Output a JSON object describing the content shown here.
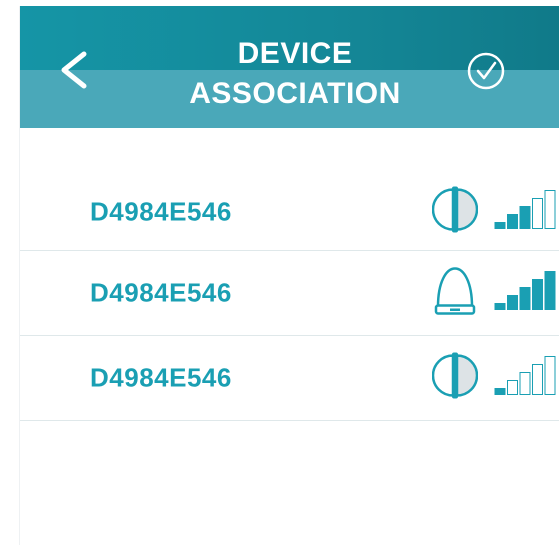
{
  "header": {
    "title_line1": "DEVICE",
    "title_line2": "ASSOCIATION",
    "back_icon": "chevron-left-icon",
    "confirm_icon": "check-circle-icon"
  },
  "devices": [
    {
      "name": "D4984E546",
      "type_icon": "half-circle-device-icon",
      "signal_level": 3,
      "signal_max": 5
    },
    {
      "name": "D4984E546",
      "type_icon": "dome-device-icon",
      "signal_level": 5,
      "signal_max": 5
    },
    {
      "name": "D4984E546",
      "type_icon": "half-circle-device-icon",
      "signal_level": 1,
      "signal_max": 5
    }
  ],
  "colors": {
    "header_dark": "#148797",
    "header_light": "#4aa8b9",
    "accent": "#1a9fb3",
    "divider": "#dfe8ea"
  }
}
